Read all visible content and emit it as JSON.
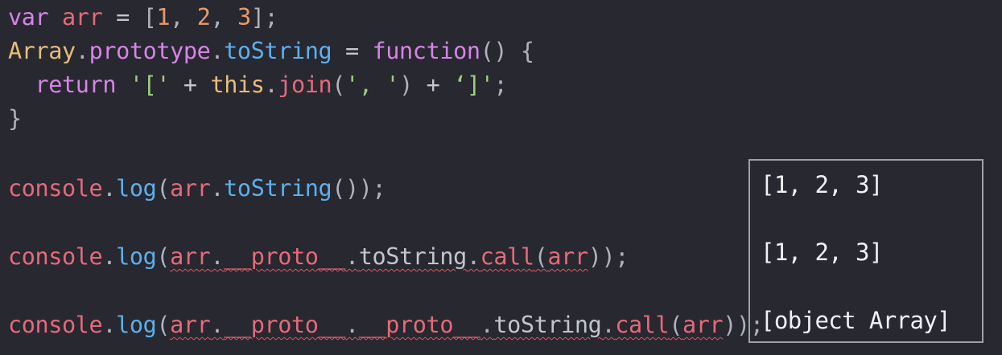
{
  "code": {
    "line1": {
      "kw": "var",
      "name": "arr",
      "eq": "=",
      "open": "[",
      "n1": "1",
      "c1": ", ",
      "n2": "2",
      "c2": ", ",
      "n3": "3",
      "close": "];"
    },
    "line2": {
      "cls": "Array",
      "dot1": ".",
      "prototype": "prototype",
      "dot2": ".",
      "method": "toString",
      "eq": "=",
      "fn": "function",
      "rest": "() {"
    },
    "line3": {
      "kw": "return",
      "s1": "'['",
      "plus1": "+",
      "this": "this",
      "dot": ".",
      "join": "join",
      "po": "(",
      "s2": "', '",
      "pc": ")",
      "plus2": "+",
      "s3": "‘]'",
      "semi": ";"
    },
    "line4": "}",
    "line5": {
      "console": "console",
      "dot": ".",
      "log": "log",
      "po": "(",
      "arr": "arr",
      "dot2": ".",
      "method": "toString",
      "rest": "());"
    },
    "line6": {
      "console": "console",
      "dot": ".",
      "log": "log",
      "po": "(",
      "arr": "arr",
      "dot2": ".",
      "proto": "__proto__",
      "dot3": ".",
      "method": "toString",
      "dot4": ".",
      "call": "call",
      "po2": "(",
      "arg": "arr",
      "rest": "));"
    },
    "line7": {
      "console": "console",
      "dot": ".",
      "log": "log",
      "po": "(",
      "arr": "arr",
      "dot2": ".",
      "proto1": "__proto__",
      "dot3": ".",
      "proto2": "__proto__",
      "dot4": ".",
      "method": "toString",
      "dot5": ".",
      "call": "call",
      "po2": "(",
      "arg": "arr",
      "rest": "));"
    }
  },
  "output": {
    "line1": "[1, 2, 3]",
    "line2": "[1, 2, 3]",
    "line3": "[object Array]"
  },
  "colors": {
    "background": "#282830",
    "keyword": "#d784e8",
    "variable": "#e8697a",
    "number": "#e89a6a",
    "class": "#e8bd7a",
    "property": "#5bb1ee",
    "string": "#9bd07c",
    "output_text": "#f0f1f4",
    "output_border": "#9ea1a8"
  }
}
